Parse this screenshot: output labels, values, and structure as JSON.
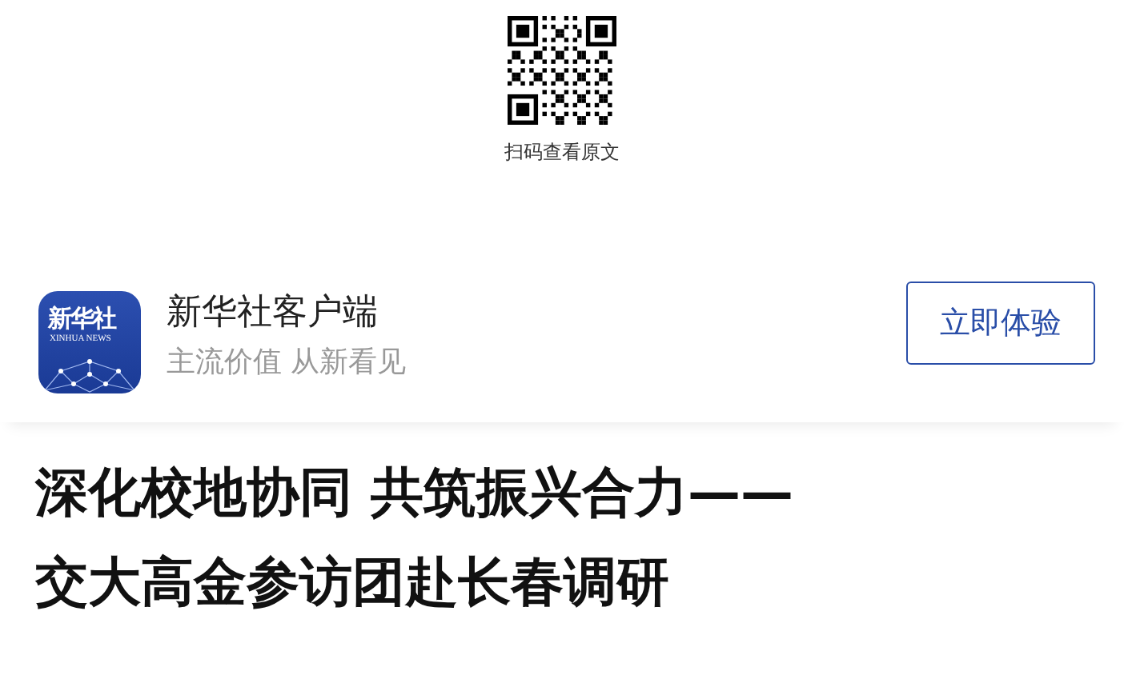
{
  "qr": {
    "caption": "扫码查看原文"
  },
  "app_banner": {
    "icon_text": "新华社",
    "icon_subtext": "XINHUA NEWS",
    "name": "新华社客户端",
    "slogan": "主流价值 从新看见",
    "button": "立即体验"
  },
  "article": {
    "title_lines": [
      "深化校地协同 共筑振兴合力——",
      "交大高金参访团赴长春调研"
    ]
  }
}
